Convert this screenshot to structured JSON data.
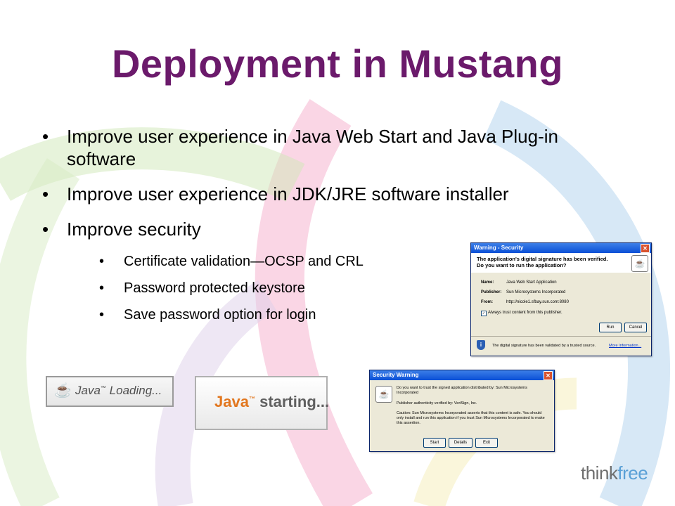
{
  "slide": {
    "title": "Deployment in Mustang",
    "bullets": [
      "Improve user experience in Java Web Start and Java Plug-in software",
      "Improve user experience in JDK/JRE software installer",
      "Improve security"
    ],
    "sub_bullets": [
      "Certificate validation—OCSP and CRL",
      "Password protected keystore",
      "Save password option for login"
    ]
  },
  "security_dialog": {
    "title": "Warning - Security",
    "heading1": "The application's digital signature has been verified.",
    "heading2": "Do you want to run the application?",
    "name_label": "Name:",
    "name_value": "Java Web Start Application",
    "publisher_label": "Publisher:",
    "publisher_value": "Sun Microsystems Incorporated",
    "from_label": "From:",
    "from_value": "http://nicole1.sfbay.sun.com:8080",
    "checkbox_label": "Always trust content from this publisher.",
    "run_button": "Run",
    "cancel_button": "Cancel",
    "footer_text": "The digital signature has been validated by a trusted source.",
    "more_info": "More Information..."
  },
  "java_loading": {
    "brand": "Java",
    "tm": "™",
    "text": "Loading..."
  },
  "java_starting": {
    "brand": "Java",
    "tm": "™",
    "text": "starting..."
  },
  "warning_dialog": {
    "title": "Security Warning",
    "line1": "Do you want to trust the signed application distributed by: Sun Microsystems Incorporated",
    "line2": "Publisher authenticity verified by: VeriSign, Inc.",
    "line3": "Caution: Sun Microsystems Incorporated asserts that this content is safe. You should only install and run this application if you trust Sun Microsystems Incorporated to make this assertion.",
    "start_button": "Start",
    "details_button": "Details",
    "exit_button": "Exit"
  },
  "brand": {
    "think": "think",
    "free": "free"
  },
  "colors": {
    "title": "#6b1a6b",
    "brand_blue": "#5aa0d6"
  }
}
